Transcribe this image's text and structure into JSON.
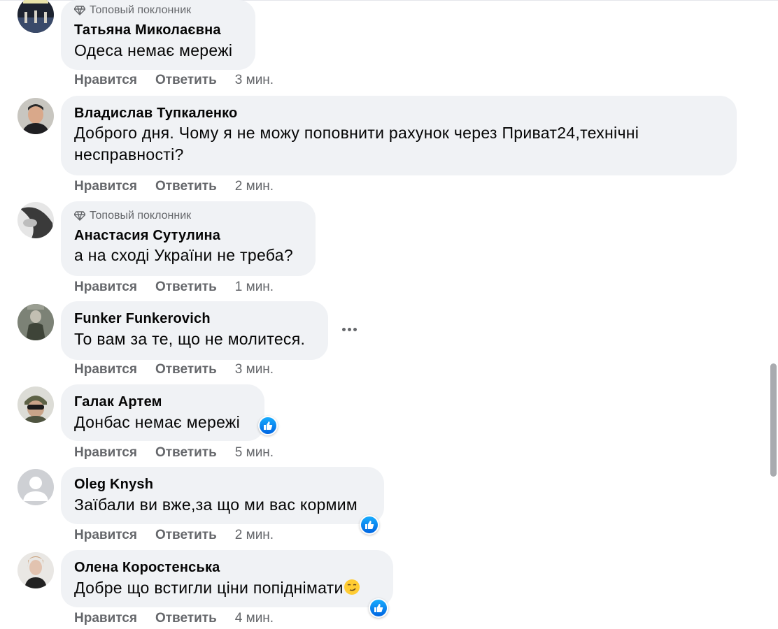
{
  "badge_text": "Топовый поклонник",
  "actions": {
    "like": "Нравится",
    "reply": "Ответить"
  },
  "comments": [
    {
      "author": "Татьяна Миколаєвна",
      "text": "Одеса немає мережі",
      "time": "3 мин."
    },
    {
      "author": "Владислав Тупкаленко",
      "text_line1": "Доброго дня. Чому я не можу поповнити рахунок через Приват24,технічні",
      "text_line2": "несправності?",
      "time": "2 мин."
    },
    {
      "author": "Анастасия Сутулина",
      "text": "а на сході України не треба?",
      "time": "1 мин."
    },
    {
      "author": "Funker Funkerovich",
      "text": "То вам за те, що не молитеся.",
      "time": "3 мин."
    },
    {
      "author": "Галак Артем",
      "text": "Донбас немає мережі",
      "time": "5 мин."
    },
    {
      "author": "Oleg Knysh",
      "text": "Заїбали ви вже,за що ми вас кормим",
      "time": "2 мин."
    },
    {
      "author": "Олена Коростенська",
      "text": "Добре що встигли ціни попіднімати",
      "time": "4 мин."
    }
  ]
}
